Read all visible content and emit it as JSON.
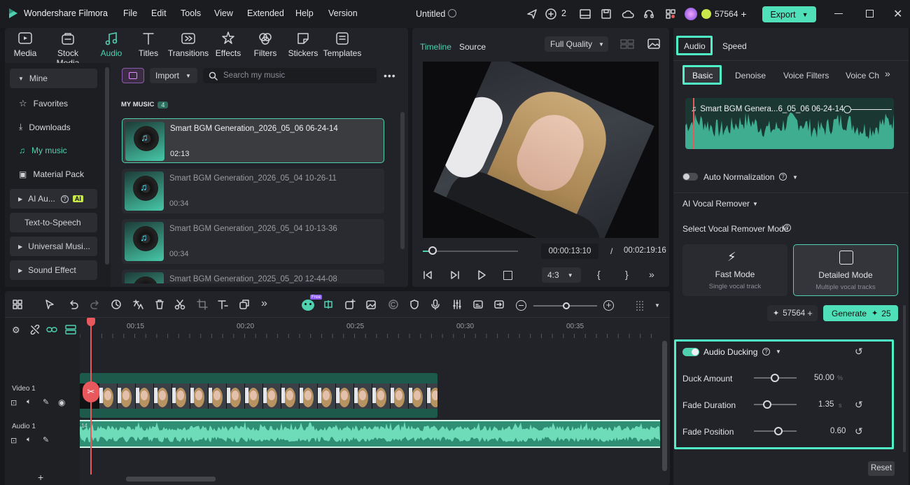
{
  "app": {
    "name": "Wondershare Filmora",
    "menu": [
      "File",
      "Edit",
      "Tools",
      "View",
      "Extended",
      "Help",
      "Version"
    ],
    "project_title": "Untitled",
    "badge_count": "2",
    "credits": "57564",
    "export_label": "Export"
  },
  "toolbar": {
    "tabs": [
      "Media",
      "Stock Media",
      "Audio",
      "Titles",
      "Transitions",
      "Effects",
      "Filters",
      "Stickers",
      "Templates"
    ],
    "active": "Audio"
  },
  "sidebar": {
    "mine": "Mine",
    "items": [
      "Favorites",
      "Downloads",
      "My music",
      "Material Pack"
    ],
    "ai_audio": "AI Au...",
    "ai_badge": "AI",
    "tts": "Text-to-Speech",
    "universal": "Universal Musi...",
    "sound_effect": "Sound Effect"
  },
  "library": {
    "import_label": "Import",
    "search_placeholder": "Search my music",
    "section_title": "MY MUSIC",
    "section_count": "4",
    "items": [
      {
        "title": "Smart BGM Generation_2026_05_06 06-24-14",
        "duration": "02:13"
      },
      {
        "title": "Smart BGM Generation_2026_05_04 10-26-11",
        "duration": "00:34"
      },
      {
        "title": "Smart BGM Generation_2026_05_04 10-13-36",
        "duration": "00:34"
      },
      {
        "title": "Smart BGM Generation_2025_05_20 12-44-08",
        "duration": ""
      }
    ]
  },
  "preview": {
    "tab_timeline": "Timeline",
    "tab_source": "Source",
    "quality": "Full Quality",
    "current_time": "00:00:13:10",
    "separator": "/",
    "total_time": "00:02:19:16",
    "aspect": "4:3",
    "progress": 0.1
  },
  "properties": {
    "tab_audio": "Audio",
    "tab_speed": "Speed",
    "subtabs": [
      "Basic",
      "Denoise",
      "Voice Filters",
      "Voice Cha"
    ],
    "clip_name": "Smart BGM Genera...6_05_06 06-24-14",
    "auto_normalization": "Auto Normalization",
    "vocal_remover": "AI Vocal Remover",
    "vocal_mode_label": "Select Vocal Remover Mode",
    "fast_mode": "Fast Mode",
    "fast_mode_sub": "Single vocal track",
    "detailed_mode": "Detailed Mode",
    "detailed_mode_sub": "Multiple vocal tracks",
    "credits": "57564",
    "generate_label": "Generate",
    "generate_cost": "25",
    "ducking_title": "Audio Ducking",
    "duck_amount_label": "Duck Amount",
    "duck_amount_value": "50.00",
    "duck_amount_unit": "%",
    "fade_duration_label": "Fade Duration",
    "fade_duration_value": "1.35",
    "fade_duration_unit": "s",
    "fade_position_label": "Fade Position",
    "fade_position_value": "0.60",
    "reset_label": "Reset"
  },
  "timeline": {
    "ruler": [
      "00:15",
      "00:20",
      "00:25",
      "00:30",
      "00:35"
    ],
    "track_video": "Video 1",
    "track_audio": "Audio 1",
    "audio_marker": "14",
    "free_badge": "Free"
  },
  "colors": {
    "accent": "#4fd1b0",
    "highlight": "#4ff0c6",
    "playhead": "#e8585c"
  }
}
